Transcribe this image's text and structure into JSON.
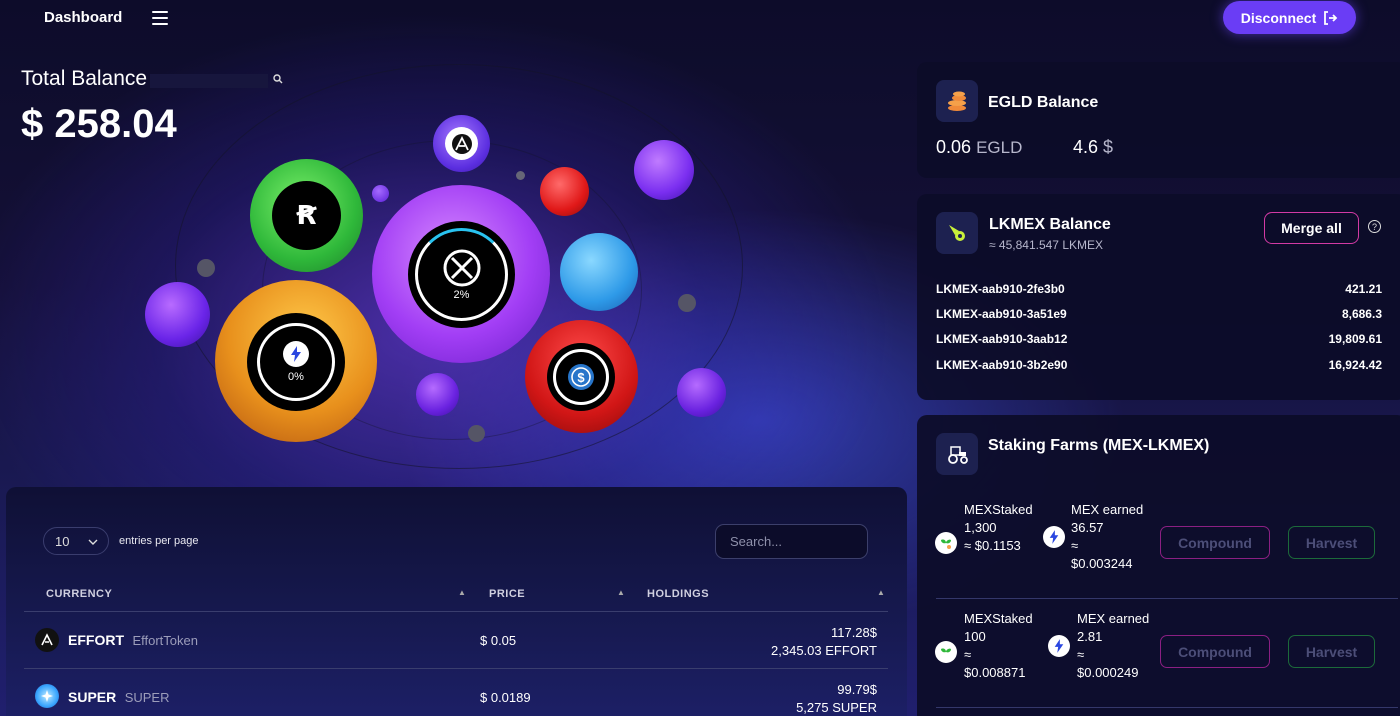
{
  "header": {
    "title": "Dashboard",
    "disconnect_label": "Disconnect"
  },
  "balance": {
    "label": "Total Balance",
    "value": "$ 258.04"
  },
  "bubbles": {
    "pct_center": "2%",
    "pct_left": "0%"
  },
  "egld": {
    "title": "EGLD Balance",
    "amount": "0.06",
    "unit": "EGLD",
    "usd": "4.6",
    "usd_unit": "$"
  },
  "lkmex": {
    "title": "LKMEX Balance",
    "subtitle": "≈ 45,841.547 LKMEX",
    "merge_label": "Merge all",
    "help": "?",
    "rows": [
      {
        "name": "LKMEX-aab910-2fe3b0",
        "value": "421.21"
      },
      {
        "name": "LKMEX-aab910-3a51e9",
        "value": "8,686.3"
      },
      {
        "name": "LKMEX-aab910-3aab12",
        "value": "19,809.61"
      },
      {
        "name": "LKMEX-aab910-3b2e90",
        "value": "16,924.42"
      }
    ]
  },
  "farms": {
    "title": "Staking Farms (MEX-LKMEX)",
    "compound_label": "Compound",
    "harvest_label": "Harvest",
    "items": [
      {
        "staked_label": "MEXStaked",
        "staked": "1,300",
        "staked_usd": "≈ $0.1153",
        "earned_label": "MEX earned",
        "earned": "36.57",
        "earned_approx": "≈",
        "earned_usd": "$0.003244"
      },
      {
        "staked_label": "MEXStaked",
        "staked": "100",
        "staked_approx": "≈",
        "staked_usd": "$0.008871",
        "earned_label": "MEX earned",
        "earned": "2.81",
        "earned_approx": "≈",
        "earned_usd": "$0.000249"
      }
    ]
  },
  "table": {
    "entries_value": "10",
    "entries_label": "entries per page",
    "search_placeholder": "Search...",
    "columns": [
      "CURRENCY",
      "PRICE",
      "HOLDINGS"
    ],
    "rows": [
      {
        "name": "EFFORT",
        "sub": "EffortToken",
        "price": "$ 0.05",
        "hold_usd": "117.28$",
        "hold_amount": "2,345.03 EFFORT"
      },
      {
        "name": "SUPER",
        "sub": "SUPER",
        "price": "$ 0.0189",
        "hold_usd": "99.79$",
        "hold_amount": "5,275 SUPER"
      }
    ]
  },
  "colors": {
    "accent": "#6a3df5",
    "merge_border": "#d23aa4",
    "compound_border": "#8b1f83",
    "harvest_border": "#1c6a3a"
  },
  "icons": [
    "menu-icon",
    "logout-icon",
    "search-icon",
    "coins-icon",
    "rocket-icon",
    "tractor-icon",
    "sprout-icon",
    "bolt-icon",
    "help-icon",
    "chevron-down-icon",
    "sort-icon"
  ]
}
